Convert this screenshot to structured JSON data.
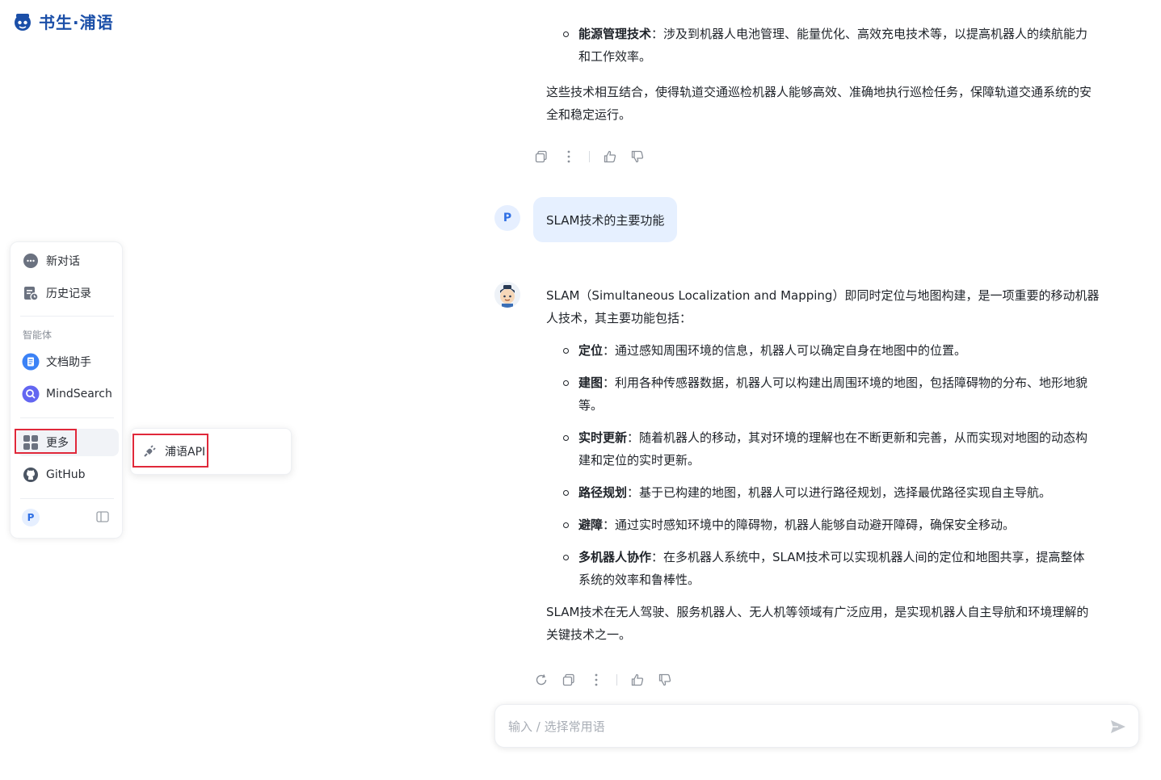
{
  "logo": {
    "text": "书生·浦语"
  },
  "sidebar": {
    "new_chat": "新对话",
    "history": "历史记录",
    "section_agents": "智能体",
    "doc_assistant": "文档助手",
    "mindsearch": "MindSearch",
    "more": "更多",
    "github": "GitHub",
    "user_initial": "P"
  },
  "popup": {
    "api_label": "浦语API"
  },
  "chat": {
    "prev_partial_label": "能源管理技术",
    "prev_partial_text": "：涉及到机器人电池管理、能量优化、高效充电技术等，以提高机器人的续航能力",
    "prev_partial_cont": "和工作效率。",
    "prev_summary_1": "这些技术相互结合，使得轨道交通巡检机器人能够高效、准确地执行巡检任务，保障轨道交通系统的安",
    "prev_summary_2": "全和稳定运行。",
    "user_initial": "P",
    "user_message": "SLAM技术的主要功能",
    "answer_intro_1": "SLAM（Simultaneous Localization and Mapping）即同时定位与地图构建，是一项重要的移动机器",
    "answer_intro_2": "人技术，其主要功能包括：",
    "items": [
      {
        "title": "定位",
        "text_1": "：通过感知周围环境的信息，机器人可以确定自身在地图中的位置。",
        "text_2": ""
      },
      {
        "title": "建图",
        "text_1": "：利用各种传感器数据，机器人可以构建出周围环境的地图，包括障碍物的分布、地形地貌",
        "text_2": "等。"
      },
      {
        "title": "实时更新",
        "text_1": "：随着机器人的移动，其对环境的理解也在不断更新和完善，从而实现对地图的动态构",
        "text_2": "建和定位的实时更新。"
      },
      {
        "title": "路径规划",
        "text_1": "：基于已构建的地图，机器人可以进行路径规划，选择最优路径实现自主导航。",
        "text_2": ""
      },
      {
        "title": "避障",
        "text_1": "：通过实时感知环境中的障碍物，机器人能够自动避开障碍，确保安全移动。",
        "text_2": ""
      },
      {
        "title": "多机器人协作",
        "text_1": "：在多机器人系统中，SLAM技术可以实现机器人间的定位和地图共享，提高整体",
        "text_2": "系统的效率和鲁棒性。"
      }
    ],
    "answer_outro_1": "SLAM技术在无人驾驶、服务机器人、无人机等领域有广泛应用，是实现机器人自主导航和环境理解的",
    "answer_outro_2": "关键技术之一。"
  },
  "input": {
    "placeholder": "输入 / 选择常用语"
  },
  "colors": {
    "brand": "#1b4fa8",
    "accent": "#2f6fe4",
    "highlight_box": "#e0283a",
    "user_bubble": "#e6f0ff"
  }
}
